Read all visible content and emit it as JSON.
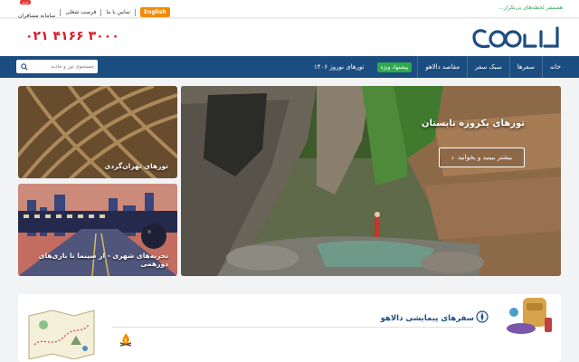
{
  "topbar": {
    "tagline": "همسفر لحظه‌های بی‌تکرار...",
    "lang_label": "English",
    "links": [
      "تماس با ما",
      "فرصت شغلی",
      "سامانه مسافران"
    ],
    "new_tag": "جدید"
  },
  "header": {
    "phone": "۰۲۱ ۴۱۶۶ ۳۰۰۰"
  },
  "nav": {
    "items": [
      "خانه",
      "سفرها",
      "سبک سفر",
      "مقاصد دالاهو",
      "تورهای نوروز ۱۴۰۶"
    ],
    "badge": "پیشنهاد ویژه",
    "search_placeholder": "جستجوی تور و جاذبه"
  },
  "hero": {
    "main_title": "تورهای یکروزه تابستان",
    "main_button": "بیشتر ببینید و بخوانید",
    "small1_label": "تورهای تهران‌گردی",
    "small2_label": "تجربه‌های شهری - از سینما تا بازی‌های دورهمی"
  },
  "section": {
    "title": "سفرهای پیمایشی دالاهو"
  },
  "colors": {
    "nav": "#1c4d80",
    "accent_red": "#d81b2a",
    "accent_green": "#2fa84f",
    "lang_orange": "#f28b00"
  }
}
